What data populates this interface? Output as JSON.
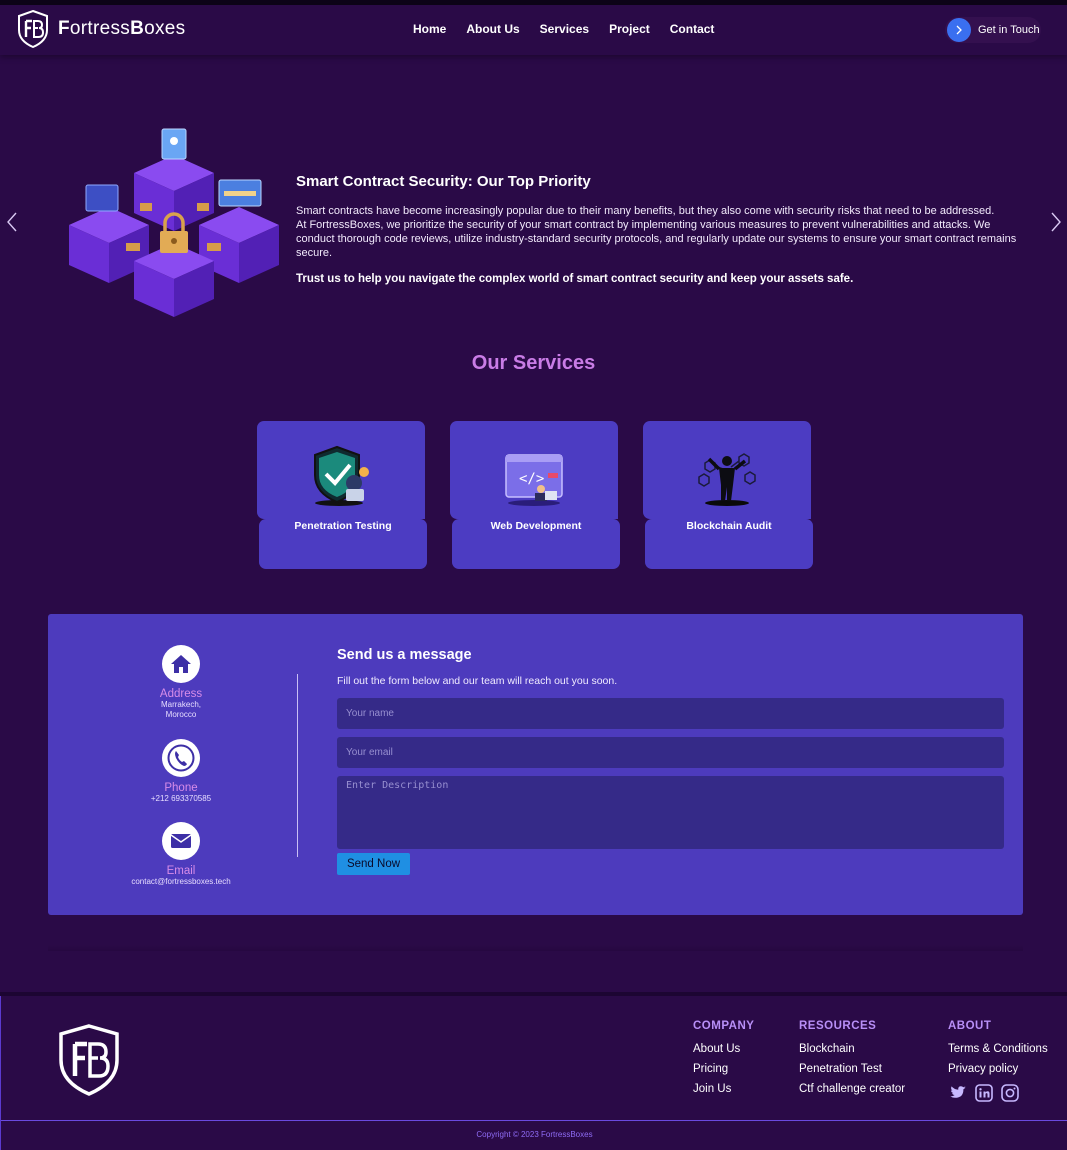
{
  "brand": {
    "name_light": "ortress",
    "name_first": "F",
    "name_bold_first": "B",
    "name_rest": "oxes",
    "monogram": "FB"
  },
  "nav": {
    "links": [
      "Home",
      "About Us",
      "Services",
      "Project",
      "Contact"
    ],
    "cta_label": "Get in Touch"
  },
  "hero": {
    "title": "Smart Contract Security: Our Top Priority",
    "paragraph_1": "Smart contracts have become increasingly popular due to their many benefits, but they also come with security risks that need to be addressed.",
    "paragraph_2": "At FortressBoxes, we prioritize the security of your smart contract by implementing various measures to prevent vulnerabilities and attacks. We conduct thorough code reviews, utilize industry-standard security protocols, and regularly update our systems to ensure your smart contract remains secure.",
    "strong": "Trust us to help you navigate the complex world of smart contract security and keep your assets safe."
  },
  "services": {
    "title": "Our Services",
    "cards": [
      {
        "label": "Penetration Testing",
        "icon": "shield-hacker-icon"
      },
      {
        "label": "Web Development",
        "icon": "code-window-icon"
      },
      {
        "label": "Blockchain Audit",
        "icon": "blockchain-person-icon"
      }
    ]
  },
  "contact": {
    "address": {
      "label": "Address",
      "value_line1": "Marrakech,",
      "value_line2": "Morocco"
    },
    "phone": {
      "label": "Phone",
      "value": "+212 693370585"
    },
    "email": {
      "label": "Email",
      "value": "contact@fortressboxes.tech"
    },
    "form": {
      "title": "Send us a message",
      "subtitle": "Fill out the form below and our team will reach out you soon.",
      "name_placeholder": "Your name",
      "email_placeholder": "Your email",
      "desc_placeholder": "Enter Description",
      "submit_label": "Send Now"
    }
  },
  "footer": {
    "columns": [
      {
        "heading": "COMPANY",
        "items": [
          "About Us",
          "Pricing",
          "Join Us"
        ]
      },
      {
        "heading": "RESOURCES",
        "items": [
          "Blockchain",
          "Penetration Test",
          "Ctf challenge creator"
        ]
      },
      {
        "heading": "ABOUT",
        "items": [
          "Terms & Conditions",
          "Privacy policy"
        ]
      }
    ],
    "socials": [
      "twitter-icon",
      "linkedin-icon",
      "instagram-icon"
    ],
    "copyright": "Copyright © 2023 FortressBoxes"
  },
  "colors": {
    "background": "#2a0a47",
    "card": "#4c3cc2",
    "accent": "#c97ce6",
    "button": "#1f8fe3"
  }
}
